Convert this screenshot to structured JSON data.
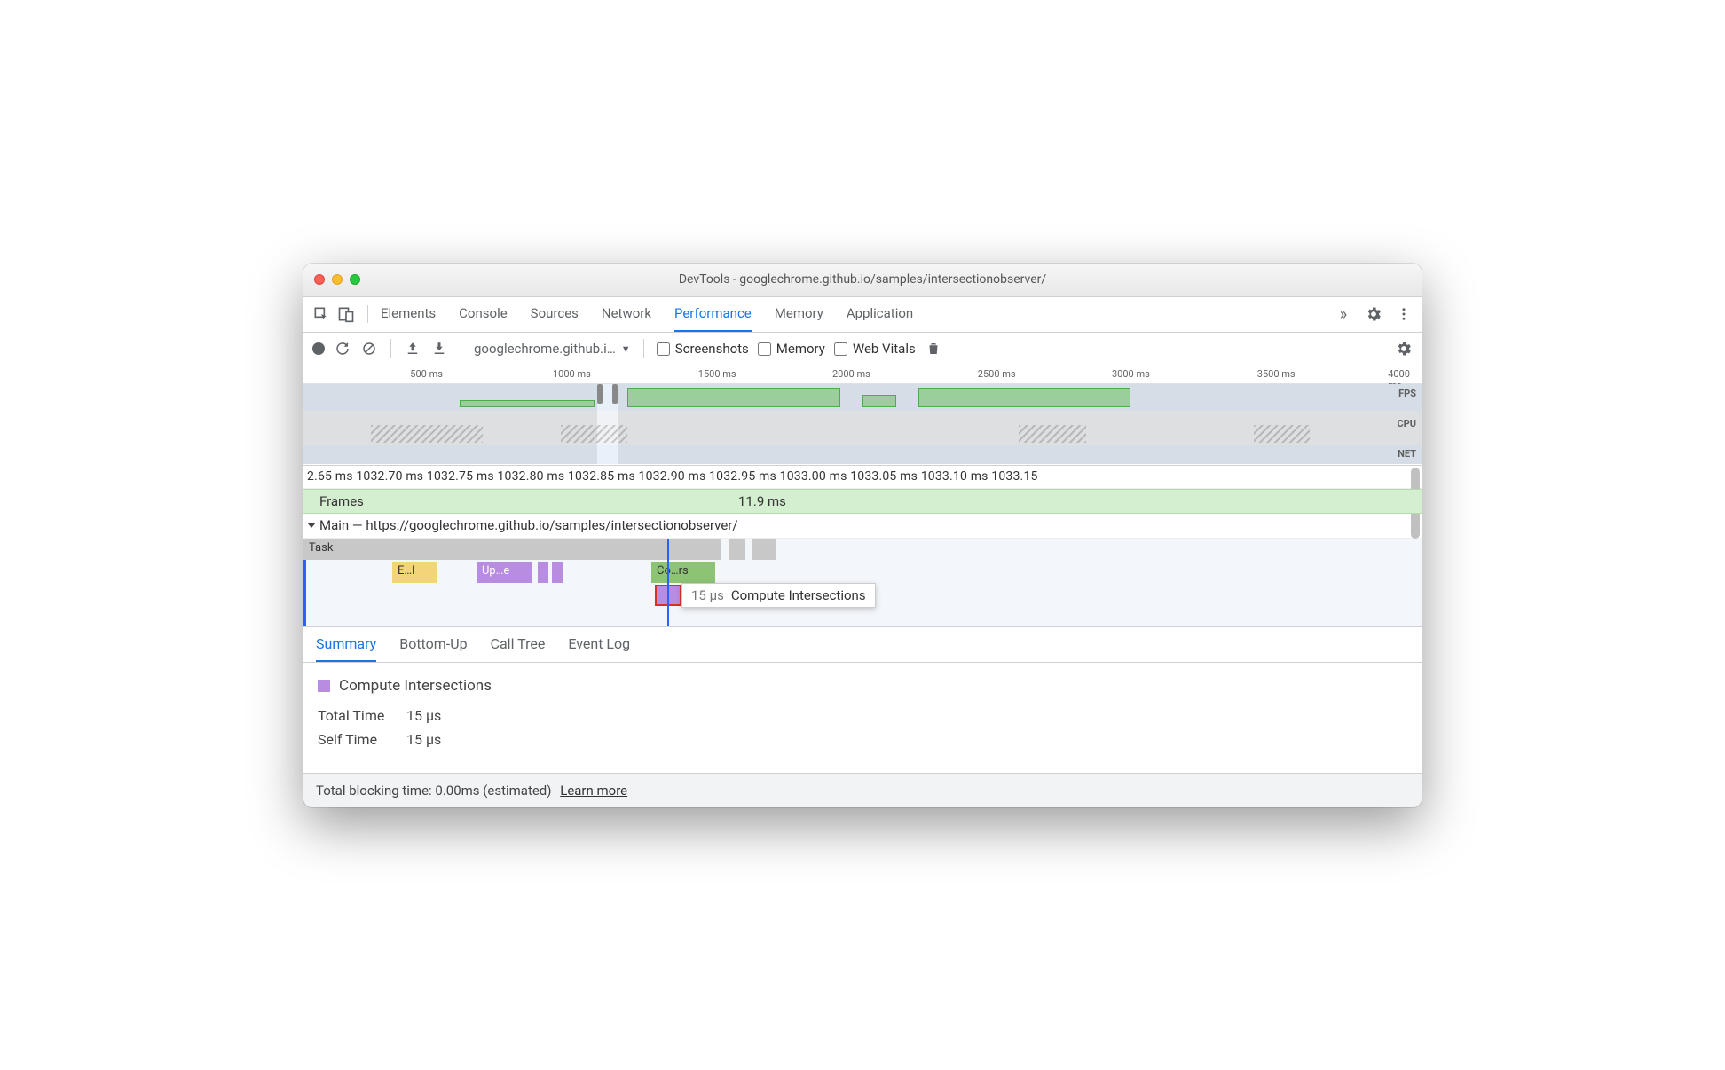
{
  "window": {
    "title": "DevTools - googlechrome.github.io/samples/intersectionobserver/"
  },
  "tabs": {
    "items": [
      "Elements",
      "Console",
      "Sources",
      "Network",
      "Performance",
      "Memory",
      "Application"
    ],
    "active": "Performance"
  },
  "toolbar": {
    "url": "googlechrome.github.i…",
    "screenshots": "Screenshots",
    "memory": "Memory",
    "web_vitals": "Web Vitals"
  },
  "overview": {
    "ticks": [
      "500 ms",
      "1000 ms",
      "1500 ms",
      "2000 ms",
      "2500 ms",
      "3000 ms",
      "3500 ms",
      "4000 ms"
    ],
    "row_labels": [
      "FPS",
      "CPU",
      "NET"
    ]
  },
  "flame_ruler": "2.65 ms 1032.70 ms 1032.75 ms 1032.80 ms 1032.85 ms 1032.90 ms 1032.95 ms 1033.00 ms 1033.05 ms 1033.10 ms 1033.15",
  "frames": {
    "label": "Frames",
    "time": "11.9 ms"
  },
  "main": {
    "header": "Main — https://googlechrome.github.io/samples/intersectionobserver/",
    "task": "Task",
    "ev1": "E…l",
    "ev2": "Up…e",
    "ev3": "Co…rs"
  },
  "tooltip": {
    "time": "15 µs",
    "name": "Compute Intersections"
  },
  "details_tabs": {
    "items": [
      "Summary",
      "Bottom-Up",
      "Call Tree",
      "Event Log"
    ],
    "active": "Summary"
  },
  "summary": {
    "name": "Compute Intersections",
    "total_k": "Total Time",
    "total_v": "15 µs",
    "self_k": "Self Time",
    "self_v": "15 µs"
  },
  "footer": {
    "text": "Total blocking time: 0.00ms (estimated)",
    "link": "Learn more"
  }
}
